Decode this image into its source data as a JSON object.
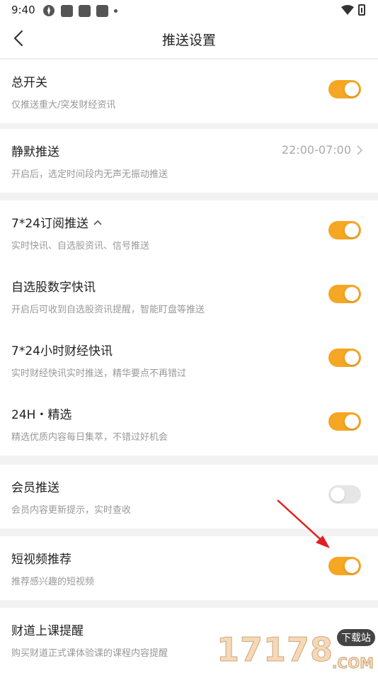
{
  "status_bar": {
    "time": "9:40"
  },
  "header": {
    "title": "推送设置"
  },
  "sections": {
    "master": {
      "title": "总开关",
      "subtitle": "仅推送重大/突发财经资讯",
      "enabled": true
    },
    "quiet": {
      "title": "静默推送",
      "subtitle": "开启后，选定时间段内无声无振动推送",
      "time_range": "22:00-07:00"
    },
    "subscriptions": [
      {
        "title": "7*24订阅推送",
        "subtitle": "实时快讯、自选股资讯、信号推送",
        "enabled": true
      },
      {
        "title": "自选股数字快讯",
        "subtitle": "开启后可收到自选股资讯提醒，智能盯盘等推送",
        "enabled": true
      },
      {
        "title": "7*24小时财经快讯",
        "subtitle": "实时财经快讯实时推送，精华要点不再错过",
        "enabled": true
      },
      {
        "title": "24H・精选",
        "subtitle": "精选优质内容每日集萃，不错过好机会",
        "enabled": true
      }
    ],
    "vip": {
      "title": "会员推送",
      "subtitle": "会员内容更新提示，实时查收",
      "enabled": false
    },
    "video": {
      "title": "短视频推荐",
      "subtitle": "推荐感兴趣的短视频",
      "enabled": true
    },
    "course": {
      "title": "财道上课提醒",
      "subtitle": "购买财道正式课体验课的课程内容提醒"
    }
  },
  "watermark": {
    "digits": "17178",
    "tag": "下载站",
    "domain": ".COM"
  },
  "colors": {
    "accent": "#f5a623",
    "toggle_off": "#e6e6e6",
    "annotation_arrow": "#e02020"
  }
}
